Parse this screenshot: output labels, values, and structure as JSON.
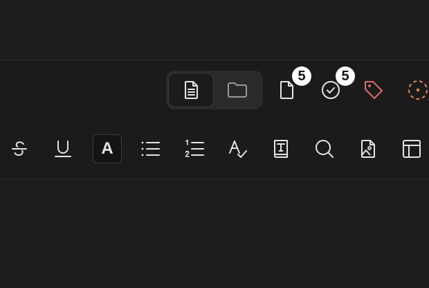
{
  "window": {
    "title": ""
  },
  "view_switcher": {
    "items": [
      {
        "name": "document-view",
        "icon": "document-lines-icon",
        "active": true
      },
      {
        "name": "folder-view",
        "icon": "folder-icon",
        "active": false
      }
    ]
  },
  "status": {
    "pages_count": "5",
    "tasks_count": "5"
  },
  "format_toolbar": {
    "text_color_label": "A"
  },
  "colors": {
    "background": "#1e1e1e",
    "toolbar": "#1b1b1b",
    "icon": "#e6e6e6",
    "icon_muted": "#9a9a9a",
    "tag_accent": "#e06b6b",
    "circle_accent": "#e8845a",
    "badge_bg": "#ffffff",
    "badge_text": "#111111"
  }
}
